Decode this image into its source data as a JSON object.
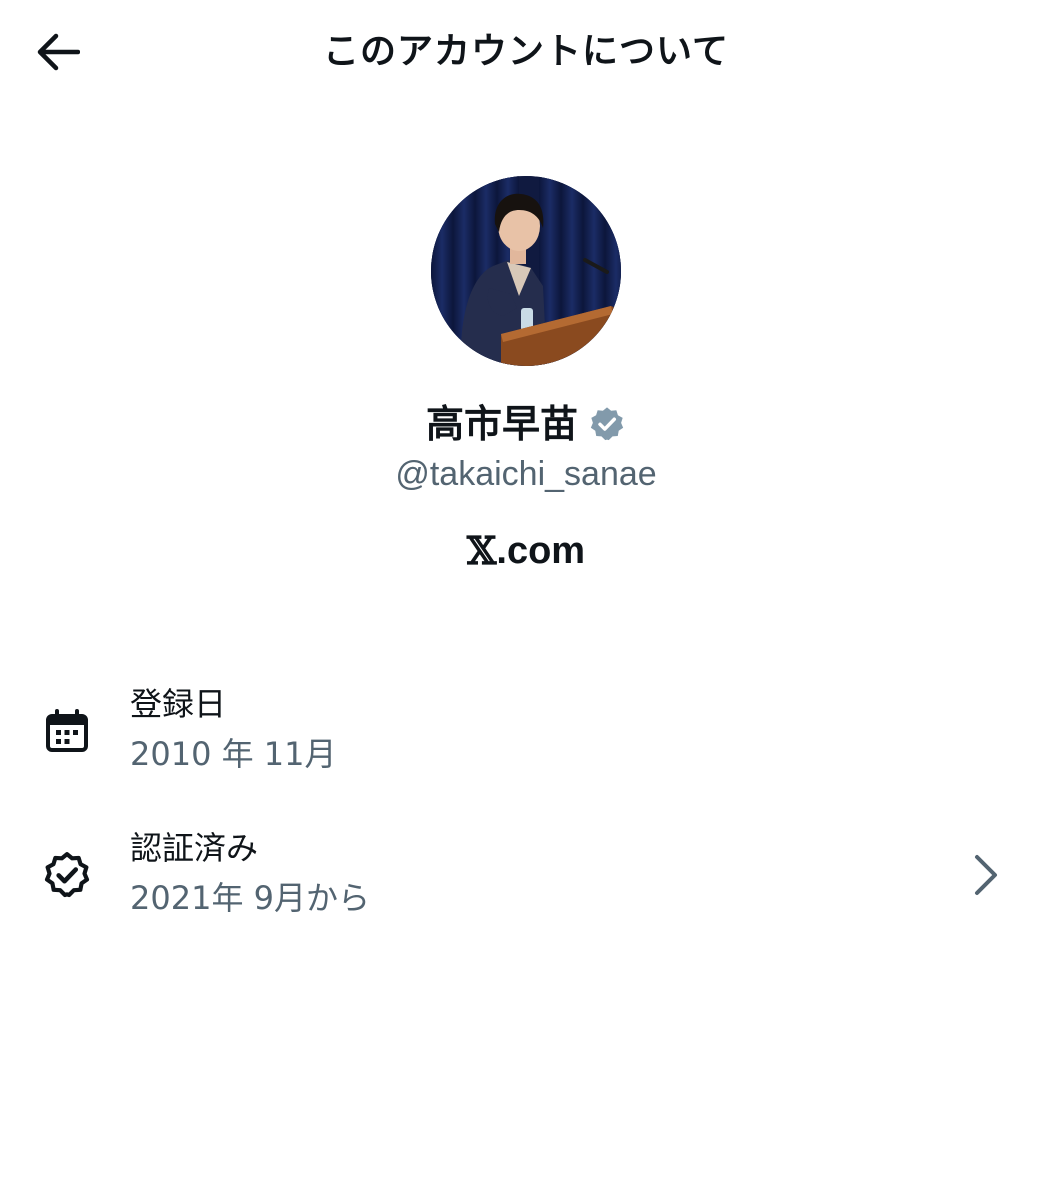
{
  "header": {
    "title": "このアカウントについて",
    "back_icon": "arrow-left-icon"
  },
  "profile": {
    "display_name": "高市早苗",
    "verified_icon": "verified-badge-icon",
    "verified_color": "#829aab",
    "handle": "@takaichi_sanae",
    "site_x": "𝕏",
    "site_com": ".com"
  },
  "details": {
    "joined": {
      "icon": "calendar-icon",
      "label": "登録日",
      "value": "2010 年 11月"
    },
    "verified": {
      "icon": "verified-outline-icon",
      "label": "認証済み",
      "value": "2021年 9月から",
      "chevron_icon": "chevron-right-icon"
    }
  },
  "colors": {
    "text_primary": "#0f1419",
    "text_secondary": "#536471",
    "background": "#ffffff"
  }
}
